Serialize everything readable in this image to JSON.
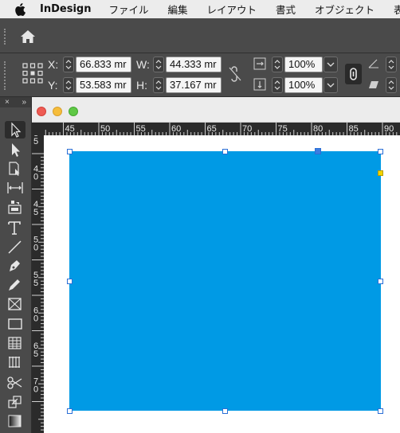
{
  "menubar": {
    "app_name": "InDesign",
    "items": [
      "ファイル",
      "編集",
      "レイアウト",
      "書式",
      "オブジェクト",
      "表"
    ]
  },
  "control": {
    "x_label": "X:",
    "y_label": "Y:",
    "w_label": "W:",
    "h_label": "H:",
    "x_value": "66.833 mr",
    "y_value": "53.583 mr",
    "w_value": "44.333 mr",
    "h_value": "37.167 mr",
    "scale_x": "100%",
    "scale_y": "100%"
  },
  "tools_panel": {
    "close_glyph": "×",
    "collapse_glyph": "»"
  },
  "ruler": {
    "h_labels": [
      "40",
      "45",
      "50",
      "55",
      "60",
      "65",
      "70",
      "75",
      "80",
      "85",
      "90"
    ],
    "v_labels": [
      "3 5",
      "4 0",
      "4 5",
      "5 0",
      "5 5",
      "6 0",
      "6 5",
      "7 0"
    ]
  },
  "colors": {
    "shape_fill": "#009ae5",
    "selection": "#2b6fd6",
    "corner_widget": "#f2d300"
  }
}
